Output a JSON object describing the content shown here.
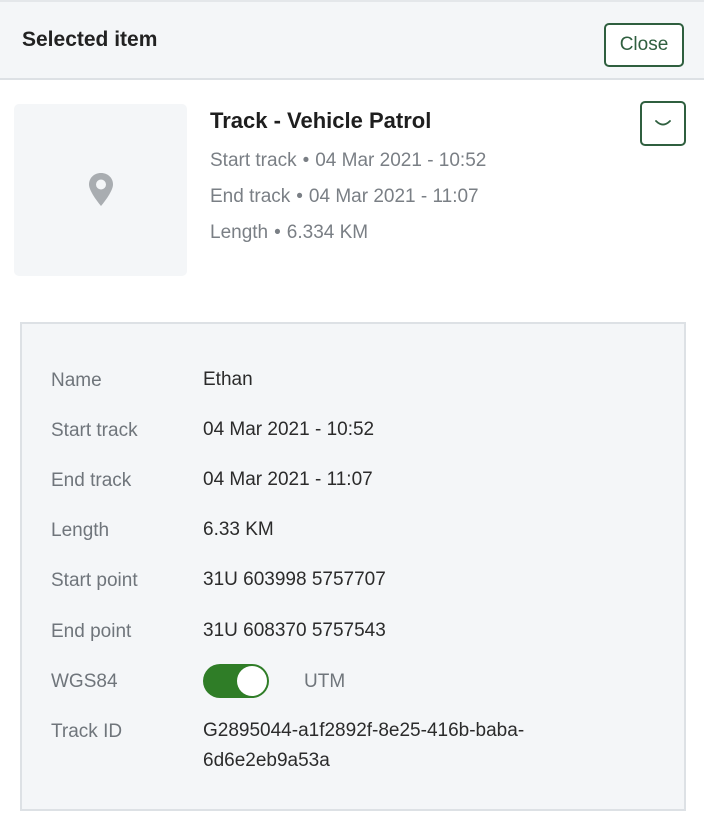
{
  "header": {
    "title": "Selected item",
    "close_label": "Close"
  },
  "summary": {
    "title": "Track - Vehicle Patrol",
    "separator": "•",
    "start_label": "Start track",
    "start_value": "04 Mar 2021 - 10:52",
    "end_label": "End track",
    "end_value": "04 Mar 2021 - 11:07",
    "length_label": "Length",
    "length_value": "6.334 KM",
    "thumbnail_icon": "map-pin-icon",
    "expand_icon": "chevron-down-icon"
  },
  "details": {
    "name": {
      "label": "Name",
      "value": "Ethan"
    },
    "start_track": {
      "label": "Start track",
      "value": "04 Mar 2021 - 10:52"
    },
    "end_track": {
      "label": "End track",
      "value": "04 Mar 2021 - 11:07"
    },
    "length": {
      "label": "Length",
      "value": "6.33 KM"
    },
    "start_point": {
      "label": "Start point",
      "value": "31U 603998 5757707"
    },
    "end_point": {
      "label": "End point",
      "value": "31U 608370 5757543"
    },
    "coord_toggle": {
      "left_label": "WGS84",
      "right_label": "UTM",
      "selected": "UTM"
    },
    "track_id": {
      "label": "Track ID",
      "value": "G2895044-a1f2892f-8e25-416b-baba-6d6e2eb9a53a"
    }
  },
  "colors": {
    "accent": "#2f5f3f",
    "toggle_on": "#2f7d27",
    "panel_bg": "#f4f6f8",
    "muted_text": "#7a7f85"
  }
}
